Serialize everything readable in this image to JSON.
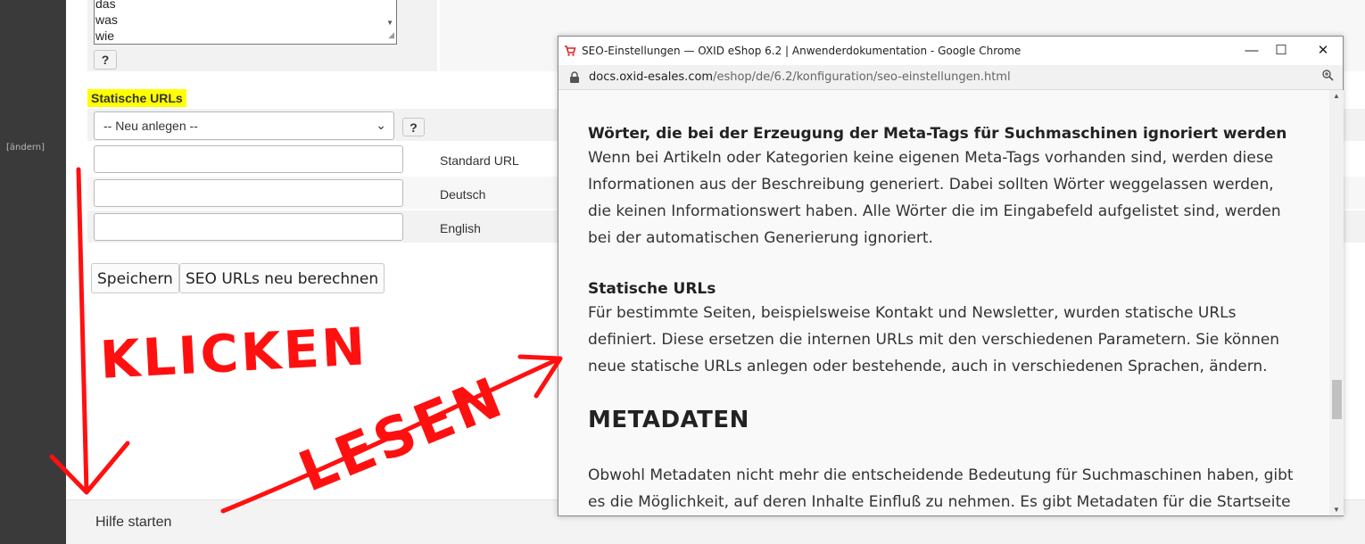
{
  "admin": {
    "sidebar_link": "[ändern]",
    "stopwords": [
      "das",
      "was",
      "wie"
    ],
    "help_symbol": "?",
    "section_title": "Statische URLs",
    "select_value": "-- Neu anlegen --",
    "languages": [
      "Standard URL",
      "Deutsch",
      "English"
    ],
    "buttons": {
      "save": "Speichern",
      "recalc": "SEO URLs neu berechnen"
    },
    "footer_help": "Hilfe starten"
  },
  "browser": {
    "title": "SEO-Einstellungen — OXID eShop 6.2 | Anwenderdokumentation - Google Chrome",
    "url_host": "docs.oxid-esales.com",
    "url_path": "/eshop/de/6.2/konfiguration/seo-einstellungen.html",
    "controls": {
      "minimize": "—",
      "maximize": "☐",
      "close": "✕"
    },
    "icons": {
      "favicon": "cart-icon",
      "lock": "lock-icon",
      "zoom": "zoom-icon"
    }
  },
  "doc": {
    "section1_heading": "Wörter, die bei der Erzeugung der Meta-Tags für Suchmaschinen ignoriert werden",
    "section1_lines": [
      "Wenn bei Artikeln oder Kategorien keine eigenen Meta-Tags vorhanden sind, werden diese",
      "Informationen aus der Beschreibung generiert. Dabei sollten Wörter weggelassen werden,",
      "die keinen Informationswert haben. Alle Wörter die im Eingabefeld aufgelistet sind, werden",
      "bei der automatischen Generierung ignoriert."
    ],
    "section2_heading": "Statische URLs",
    "section2_lines": [
      "Für bestimmte Seiten, beispielsweise Kontakt und Newsletter, wurden statische URLs",
      "definiert. Diese ersetzen die internen URLs mit den verschiedenen Parametern. Sie können",
      "neue statische URLs anlegen oder bestehende, auch in verschiedenen Sprachen, ändern."
    ],
    "heading_metadaten": "METADATEN",
    "section3_lines": [
      "Obwohl Metadaten nicht mehr die entscheidende Bedeutung für Suchmaschinen haben, gibt",
      "es die Möglichkeit, auf deren Inhalte Einfluß zu nehmen. Es gibt Metadaten für die Startseite"
    ]
  },
  "annotations": {
    "klicken": "KLICKEN",
    "lesen": "LESEN",
    "color": "#ff1010"
  },
  "colors": {
    "highlight": "#ffff00",
    "admin_sidebar": "#3a3a3a"
  }
}
